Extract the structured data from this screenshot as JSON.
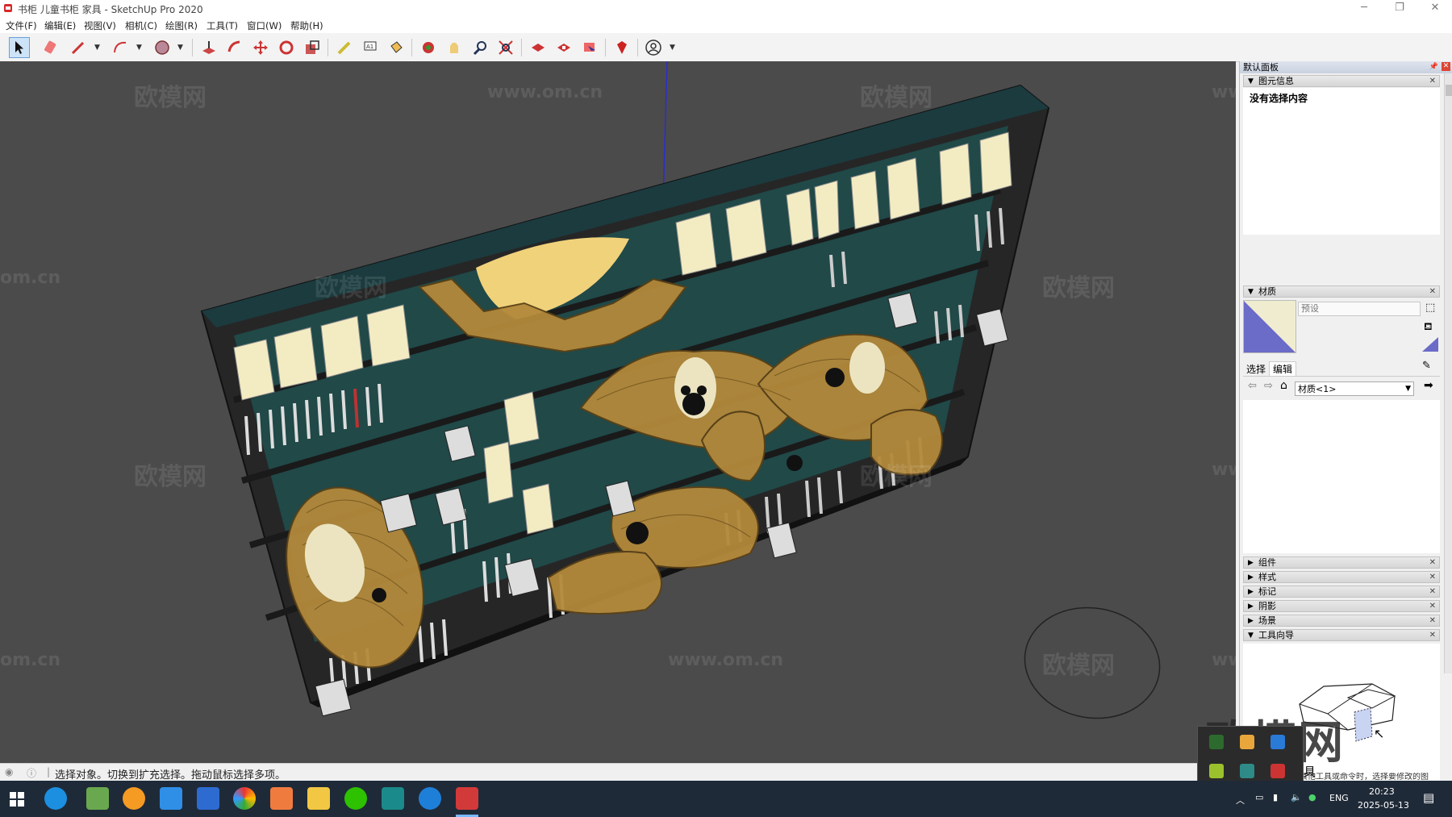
{
  "window": {
    "title": "书柜 儿童书柜 家具 - SketchUp Pro 2020",
    "minimize": "─",
    "restore": "❐",
    "close": "✕"
  },
  "menu": [
    "文件(F)",
    "编辑(E)",
    "视图(V)",
    "相机(C)",
    "绘图(R)",
    "工具(T)",
    "窗口(W)",
    "帮助(H)"
  ],
  "toolbar": {
    "icons": [
      "select-arrow",
      "eraser",
      "pencil-line",
      "arc",
      "shapes",
      "push-pull",
      "offset",
      "move",
      "rotate",
      "scale",
      "tape-measure",
      "text",
      "paint-bucket",
      "orbit",
      "pan",
      "zoom",
      "zoom-extents",
      "warehouse",
      "extension-warehouse",
      "send-to-layout",
      "ruby-extension",
      "account"
    ]
  },
  "viewport": {
    "watermarks": [
      "欧模网",
      "www.om.cn",
      "欧模网",
      "www.om.cn",
      "om.cn",
      "欧模网",
      "欧模网",
      "欧模网",
      "www.om.cn",
      "欧模网",
      "om.cn",
      "www.om.cn",
      "欧模网",
      "www.om.cn"
    ]
  },
  "status": {
    "text": "选择对象。切换到扩充选择。拖动鼠标选择多项。"
  },
  "panel": {
    "title": "默认面板",
    "entity_info": {
      "header": "图元信息",
      "value": "没有选择内容"
    },
    "materials": {
      "header": "材质",
      "preset_placeholder": "预设",
      "tab_select": "选择",
      "tab_edit": "编辑",
      "dropdown_value": "材质<1>"
    },
    "collapsed": [
      "组件",
      "样式",
      "标记",
      "阴影",
      "场景"
    ],
    "instructor": {
      "header": "工具向导",
      "tool_title": "工具",
      "desc": "用其他工具或命令时，选择要修改的图元。"
    },
    "logo_text": "欧模网"
  },
  "taskbar": {
    "lang": "ENG",
    "time": "20:23",
    "date": "2025-05-13"
  },
  "colors": {
    "viewport_bg": "#4b4b4b",
    "shelf": "#2c2c2c",
    "wood": "#b38a3c",
    "material_swatch": "#6b6bc8",
    "taskbar": "#1f2a38"
  }
}
